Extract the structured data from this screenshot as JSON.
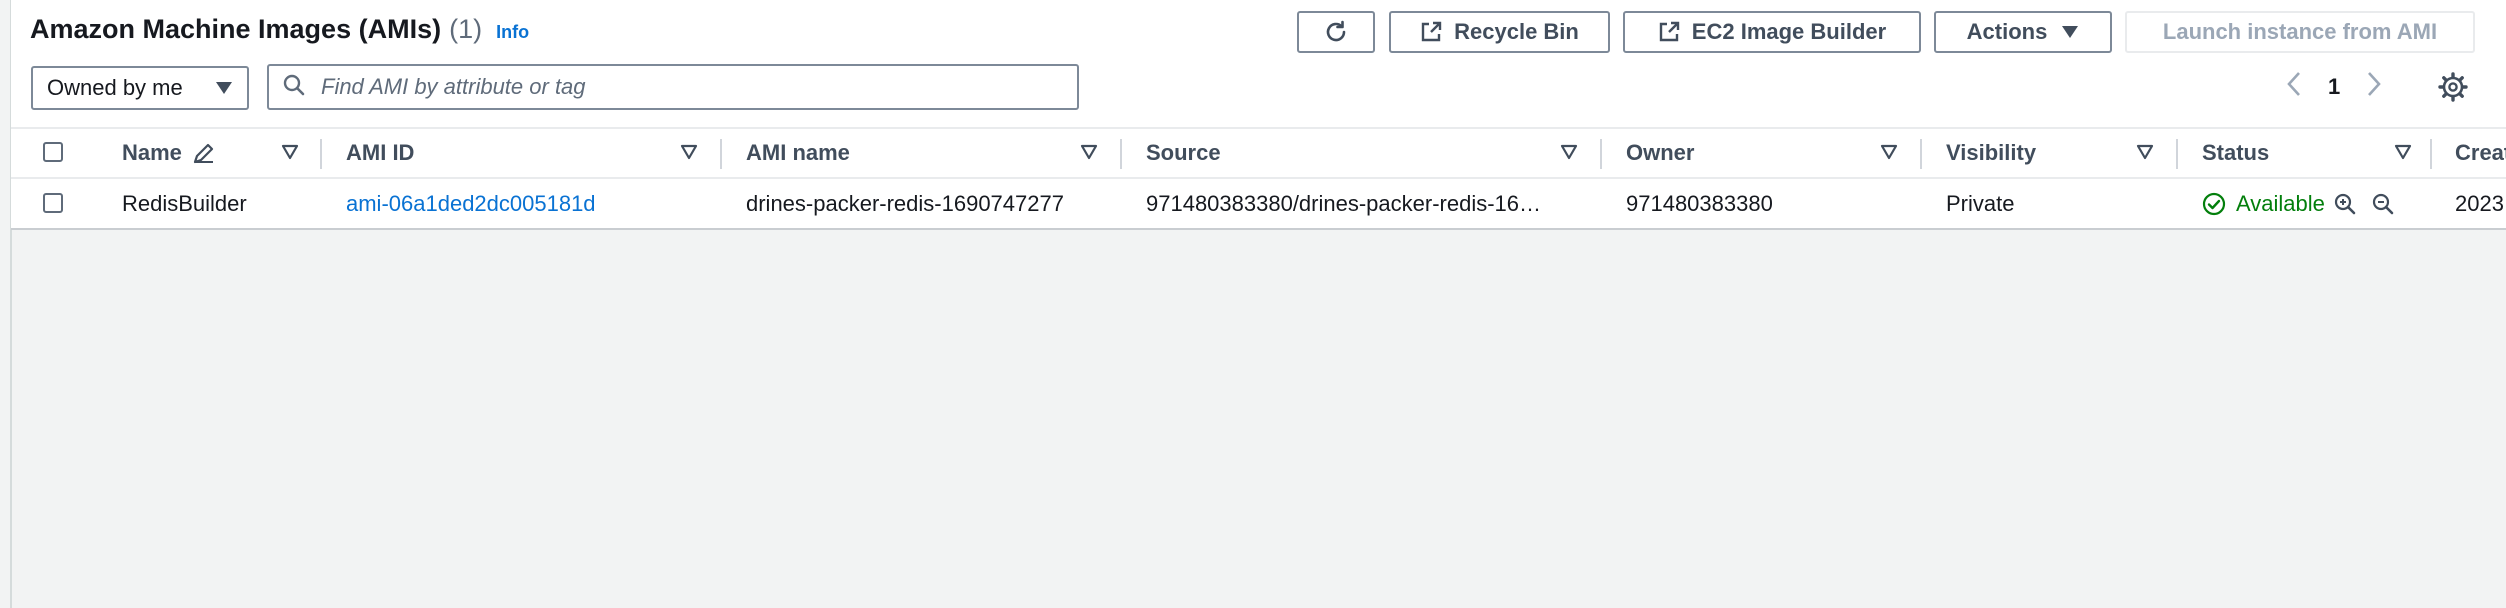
{
  "header": {
    "title": "Amazon Machine Images (AMIs)",
    "count": "(1)",
    "info_label": "Info"
  },
  "toolbar": {
    "refresh_icon": "refresh-icon",
    "recycle_bin_label": "Recycle Bin",
    "image_builder_label": "EC2 Image Builder",
    "actions_label": "Actions",
    "launch_label": "Launch instance from AMI"
  },
  "filters": {
    "owner_select_value": "Owned by me",
    "search_placeholder": "Find AMI by attribute or tag",
    "search_value": ""
  },
  "pagination": {
    "current_page": "1"
  },
  "table": {
    "columns": [
      "Name",
      "AMI ID",
      "AMI name",
      "Source",
      "Owner",
      "Visibility",
      "Status",
      "Creat"
    ],
    "rows": [
      {
        "name": "RedisBuilder",
        "ami_id": "ami-06a1ded2dc005181d",
        "ami_name": "drines-packer-redis-1690747277",
        "source": "971480383380/drines-packer-redis-16…",
        "owner": "971480383380",
        "visibility": "Private",
        "status": "Available",
        "creation": "2023"
      }
    ]
  },
  "colors": {
    "link": "#0972d3",
    "success": "#037f0c",
    "border": "#7d8998"
  }
}
